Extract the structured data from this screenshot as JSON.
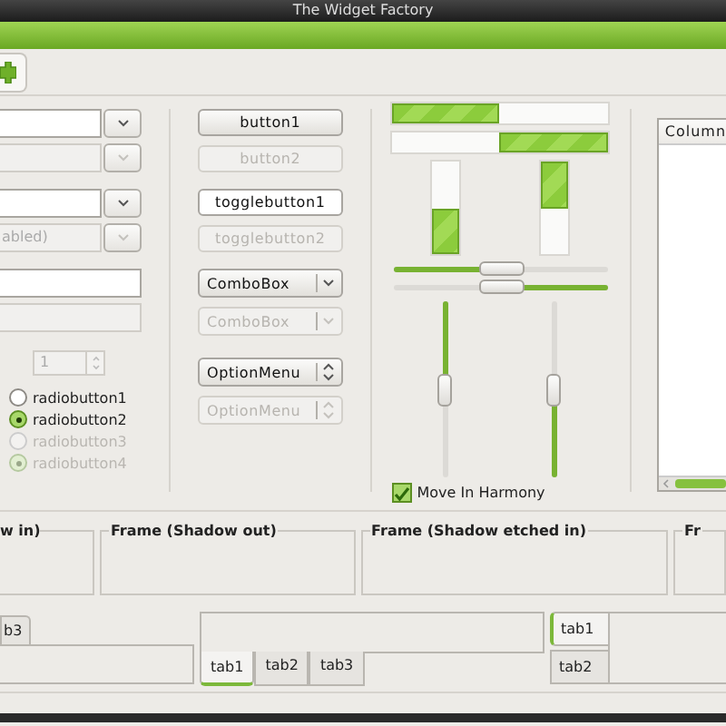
{
  "window": {
    "title": "The Widget Factory"
  },
  "column_1": [
    [
      {
        "kind": "combo_entry",
        "disabled": false
      },
      {
        "kind": "combo_entry",
        "disabled": true
      }
    ],
    [
      {
        "kind": "combo_entry",
        "disabled": false
      },
      {
        "kind": "combo_entry",
        "disabled": true,
        "value": "abled)"
      }
    ],
    [
      {
        "kind": "entry",
        "disabled": false
      },
      {
        "kind": "entry",
        "disabled": true
      }
    ],
    [
      {
        "kind": "spin",
        "disabled": true,
        "value": "1"
      }
    ],
    [
      {
        "kind": "radio",
        "label": "radiobutton1",
        "selected": false,
        "disabled": false
      },
      {
        "kind": "radio",
        "label": "radiobutton2",
        "selected": true,
        "disabled": false
      },
      {
        "kind": "radio",
        "label": "radiobutton3",
        "selected": false,
        "disabled": true
      },
      {
        "kind": "radio",
        "label": "radiobutton4",
        "selected": true,
        "disabled": true
      }
    ]
  ],
  "column_2": [
    [
      {
        "kind": "button",
        "label": "button1",
        "disabled": false
      },
      {
        "kind": "button",
        "label": "button2",
        "disabled": true
      }
    ],
    [
      {
        "kind": "toggle_button",
        "label": "togglebutton1",
        "disabled": false
      },
      {
        "kind": "toggle_button",
        "label": "togglebutton2",
        "disabled": true
      }
    ],
    [
      {
        "kind": "combo_box",
        "label": "ComboBox",
        "disabled": false
      },
      {
        "kind": "combo_box",
        "label": "ComboBox",
        "disabled": true
      }
    ],
    [
      {
        "kind": "option_menu",
        "label": "OptionMenu",
        "disabled": false
      },
      {
        "kind": "option_menu",
        "label": "OptionMenu",
        "disabled": true
      }
    ]
  ],
  "column_3": {
    "horizontal_progress_bars": [
      {
        "level": 0.5,
        "inverted": false
      },
      {
        "level": 0.5,
        "inverted": true
      }
    ],
    "vertical_progress_bars": [
      {
        "level": 0.5,
        "inverted": false
      },
      {
        "level": 0.5,
        "inverted": true
      }
    ],
    "horizontal_scales": [
      {
        "level": 0.5,
        "inverted": false
      },
      {
        "level": 0.5,
        "inverted": true
      }
    ],
    "vertical_scales": [
      {
        "level": 0.5,
        "inverted": true
      },
      {
        "level": 0.5,
        "inverted": false
      }
    ],
    "check": {
      "label": "Move In Harmony",
      "checked": true
    }
  },
  "tree": {
    "columns": [
      "Column"
    ]
  },
  "frames": [
    {
      "label": "w in)"
    },
    {
      "label": "Frame (Shadow out)"
    },
    {
      "label": "Frame (Shadow etched in)"
    },
    {
      "label": "Fr"
    }
  ],
  "notebooks": [
    {
      "kind": "top",
      "tabs": [
        {
          "label": "b3",
          "selected": false
        }
      ]
    },
    {
      "kind": "bottom",
      "tabs": [
        {
          "label": "tab1",
          "selected": true
        },
        {
          "label": "tab2",
          "selected": false
        },
        {
          "label": "tab3",
          "selected": false
        }
      ]
    },
    {
      "kind": "left",
      "tabs": [
        {
          "label": "tab1",
          "selected": true
        },
        {
          "label": "tab2",
          "selected": false
        }
      ]
    }
  ]
}
